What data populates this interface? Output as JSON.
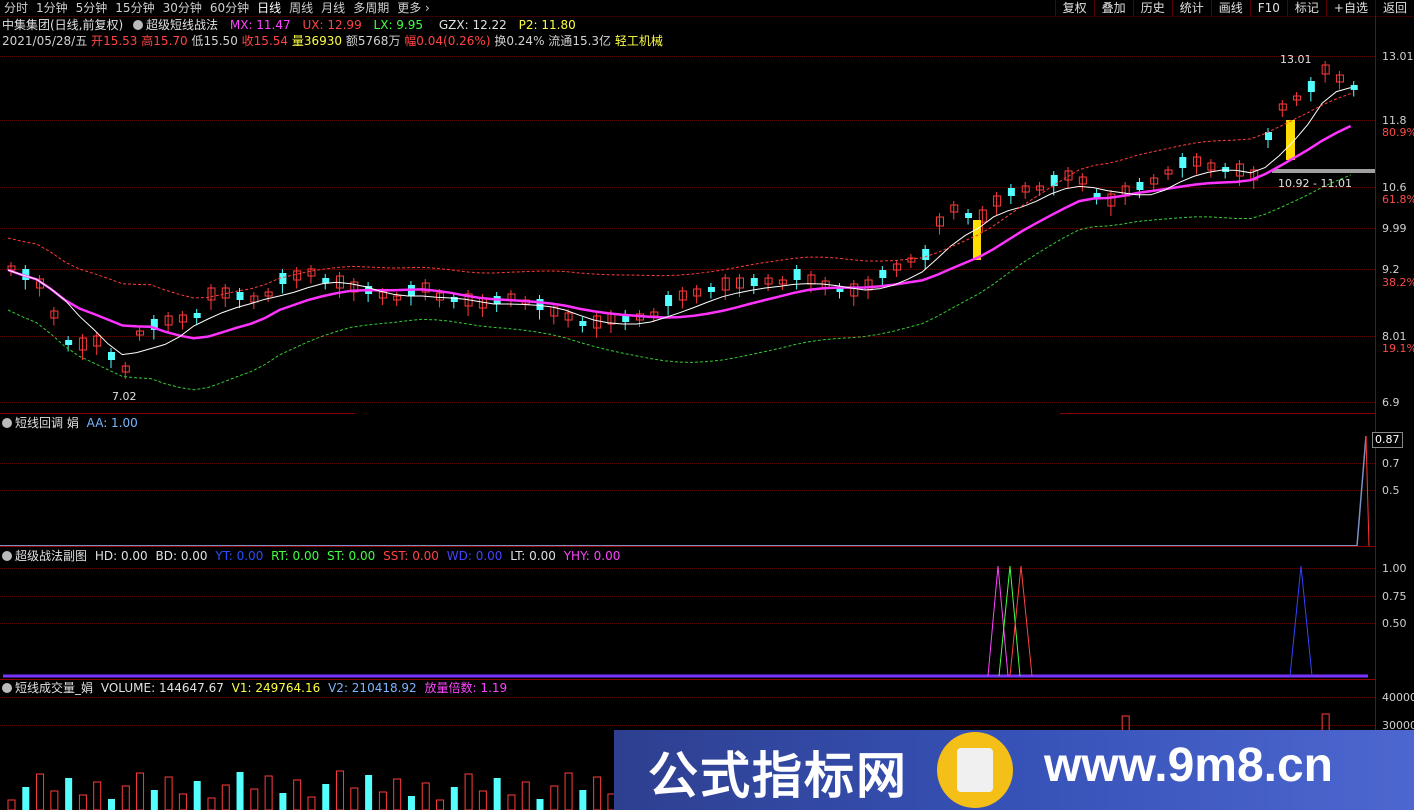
{
  "toolbar": {
    "periods": [
      "分时",
      "1分钟",
      "5分钟",
      "15分钟",
      "30分钟",
      "60分钟",
      "日线",
      "周线",
      "月线",
      "多周期",
      "更多"
    ],
    "active_period": "日线",
    "more_chevron": "›",
    "buttons": [
      "复权",
      "叠加",
      "历史",
      "统计",
      "画线",
      "F10",
      "标记",
      "+自选",
      "返回"
    ]
  },
  "stock": {
    "title": "中集集团(日线,前复权)",
    "indicator": "超级短线战法",
    "mx": "MX: 11.47",
    "ux": "UX: 12.99",
    "lx": "LX: 9.95",
    "gzx": "GZX: 12.22",
    "p2": "P2: 11.80"
  },
  "quote": {
    "date": "2021/05/28/五",
    "open_label": "开",
    "open": "15.53",
    "high_label": "高",
    "high": "15.70",
    "low_label": "低",
    "low": "15.50",
    "close_label": "收",
    "close": "15.54",
    "vol_label": "量",
    "vol": "36930",
    "amt_label": "额",
    "amt": "5768万",
    "chg_label": "幅",
    "chg": "0.04(0.26%)",
    "turn_label": "换",
    "turn": "0.24%",
    "float_label": "流通",
    "float": "15.3亿",
    "industry": "轻工机械"
  },
  "main_chart": {
    "price_ticks": [
      "13.01",
      "11.8",
      "80.9%",
      "10.6",
      "61.8%",
      "9.99",
      "9.2",
      "38.2%",
      "8.01",
      "19.1%",
      "6.9"
    ],
    "annotations": {
      "high_label": "13.01",
      "low_label": "7.02",
      "range_label": "10.92 - 11.01"
    }
  },
  "panel2": {
    "title": "短线回调 娟",
    "aa": "AA: 1.00",
    "ticks": [
      "0.87",
      "0.7",
      "0.5"
    ],
    "value_label": "0.87"
  },
  "panel3": {
    "title": "超级战法副图",
    "hd": "HD: 0.00",
    "bd": "BD: 0.00",
    "yt": "YT: 0.00",
    "rt": "RT: 0.00",
    "st": "ST: 0.00",
    "sst": "SST: 0.00",
    "wd": "WD: 0.00",
    "lt": "LT: 0.00",
    "yhy": "YHY: 0.00",
    "ticks": [
      "1.00",
      "0.75",
      "0.50"
    ]
  },
  "panel4": {
    "title": "短线成交量_娟",
    "volume": "VOLUME: 144647.67",
    "v1": "V1: 249764.16",
    "v2": "V2: 210418.92",
    "ratio": "放量倍数: 1.19",
    "ticks": [
      "40000",
      "30000"
    ]
  },
  "watermark": {
    "cn": "公式指标网",
    "url": "www.9m8.cn"
  },
  "colors": {
    "up": "#ff3b3b",
    "down": "#54ffff",
    "ma_main": "#ff33ff",
    "upper_band": "#ff3b3b",
    "lower_band": "#33cc33",
    "highlight_bar": "#ffdd00",
    "gray_bar": "#a0a0a0"
  }
}
